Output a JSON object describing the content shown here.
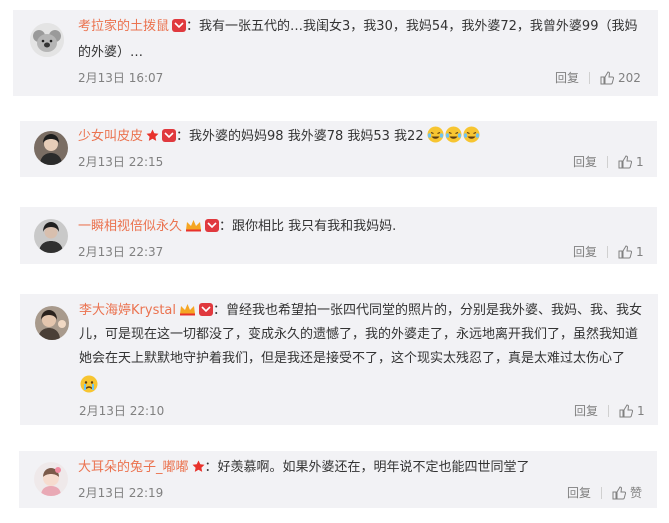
{
  "comments": [
    {
      "username": "考拉家的土拨鼠",
      "separator": "：",
      "text_lines": [
        "我有一张五代的…我闺女3，我30，我妈54，我外婆72，我曾外婆99（我妈",
        "的外婆）…"
      ],
      "date": "2月13日 16:07",
      "reply_label": "回复",
      "like_count": "202"
    },
    {
      "username": "少女叫皮皮",
      "separator": "：",
      "text_lines": [
        "我外婆的妈妈98 我外婆78 我妈53 我22"
      ],
      "date": "2月13日 22:15",
      "reply_label": "回复",
      "like_count": "1"
    },
    {
      "username": "一瞬相视倍似永久",
      "separator": "：",
      "text_lines": [
        "跟你相比  我只有我和我妈妈."
      ],
      "date": "2月13日 22:37",
      "reply_label": "回复",
      "like_count": "1"
    },
    {
      "username": "李大海婷Krystal",
      "separator": "：",
      "text_lines": [
        "曾经我也希望拍一张四代同堂的照片的，分别是我外婆、我妈、我、我女",
        "儿，可是现在这一切都没了，变成永久的遗憾了，我的外婆走了，永远地离开我们了，虽然我知道",
        "她会在天上默默地守护着我们，但是我还是接受不了，这个现实太残忍了，真是太难过太伤心了"
      ],
      "date": "2月13日 22:10",
      "reply_label": "回复",
      "like_count": "1"
    },
    {
      "username": "大耳朵的兔子_嘟嘟",
      "separator": "：",
      "text_lines": [
        "好羡慕啊。如果外婆还在，明年说不定也能四世同堂了"
      ],
      "date": "2月13日 22:19",
      "reply_label": "回复",
      "like_count": "赞"
    }
  ],
  "colors": {
    "username": "#eb7350",
    "meta": "#808080",
    "card_bg": "#f2f2f5",
    "badge_red": "#e0393e",
    "star_red": "#e8322b"
  }
}
